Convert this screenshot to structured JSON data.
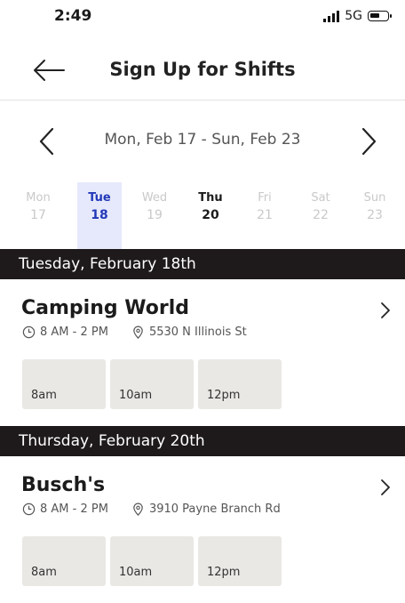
{
  "status_bar": {
    "time": "2:49",
    "network": "5G"
  },
  "header": {
    "title": "Sign Up for Shifts"
  },
  "week": {
    "range": "Mon, Feb 17 - Sun, Feb 23"
  },
  "days": [
    {
      "name": "Mon",
      "date": "17"
    },
    {
      "name": "Tue",
      "date": "18"
    },
    {
      "name": "Wed",
      "date": "19"
    },
    {
      "name": "Thu",
      "date": "20"
    },
    {
      "name": "Fri",
      "date": "21"
    },
    {
      "name": "Sat",
      "date": "22"
    },
    {
      "name": "Sun",
      "date": "23"
    }
  ],
  "sections": [
    {
      "heading": "Tuesday, February 18th",
      "job": {
        "name": "Camping World",
        "time": "8 AM - 2 PM",
        "location": "5530 N Illinois St"
      },
      "slots": [
        "8am",
        "10am",
        "12pm"
      ]
    },
    {
      "heading": "Thursday, February 20th",
      "job": {
        "name": "Busch's",
        "time": "8 AM - 2 PM",
        "location": "3910 Payne Branch Rd"
      },
      "slots": [
        "8am",
        "10am",
        "12pm"
      ]
    }
  ],
  "colors": {
    "selected_day_bg": "#e6e9fb",
    "selected_day_text": "#2339b8",
    "section_bar": "#1e1a1b",
    "slot_bg": "#e9e8e4"
  },
  "icons": {
    "back": "arrow-left-icon",
    "prev": "chevron-left-icon",
    "next": "chevron-right-icon",
    "clock": "clock-icon",
    "location": "location-pin-icon"
  }
}
